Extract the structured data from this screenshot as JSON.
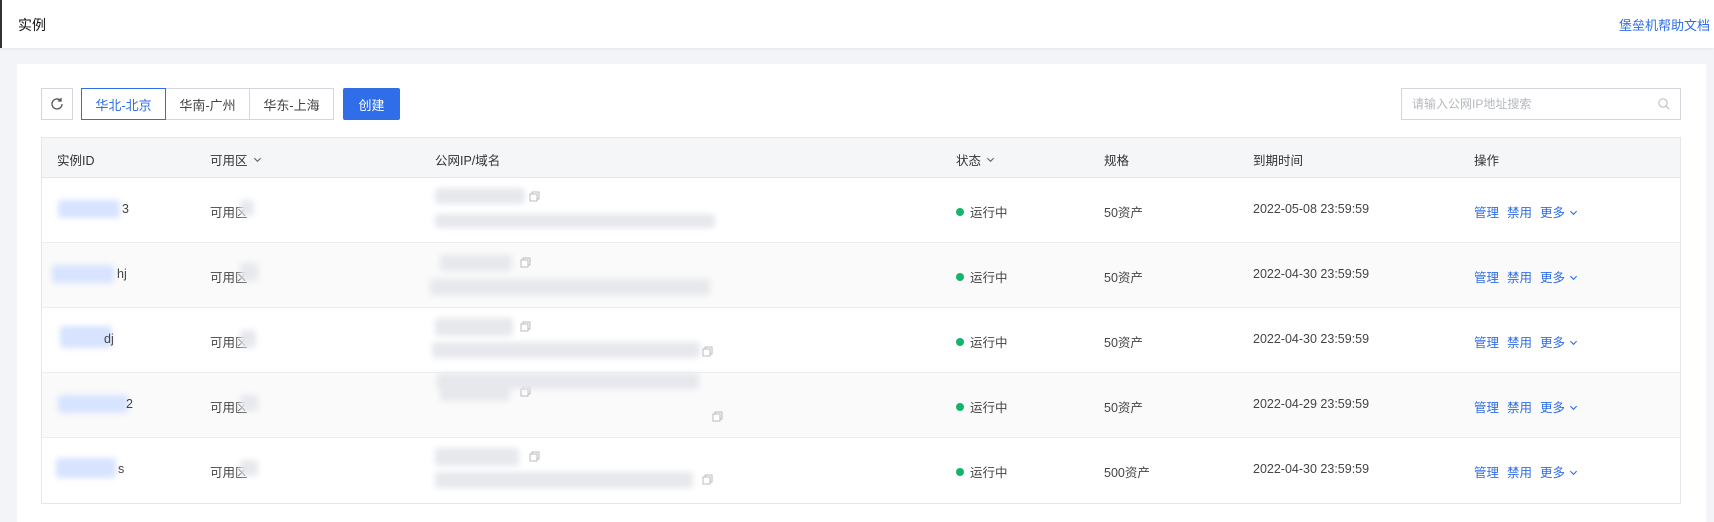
{
  "header": {
    "title": "实例",
    "help_link": "堡垒机帮助文档"
  },
  "toolbar": {
    "regions": [
      "华北-北京",
      "华南-广州",
      "华东-上海"
    ],
    "active_region": "华北-北京",
    "create_label": "创建",
    "search_placeholder": "请输入公网IP地址搜索"
  },
  "table": {
    "columns": [
      "实例ID",
      "可用区",
      "公网IP/域名",
      "状态",
      "规格",
      "到期时间",
      "操作"
    ],
    "rows": [
      {
        "id_tail": "3",
        "zone": "可用区",
        "status": "运行中",
        "spec": "50资产",
        "expire": "2022-05-08 23:59:59"
      },
      {
        "id_tail": "hj",
        "zone": "可用区",
        "status": "运行中",
        "spec": "50资产",
        "expire": "2022-04-30 23:59:59"
      },
      {
        "id_tail": "dj",
        "zone": "可用区",
        "status": "运行中",
        "spec": "50资产",
        "expire": "2022-04-30 23:59:59"
      },
      {
        "id_tail": "2",
        "zone": "可用区",
        "status": "运行中",
        "spec": "50资产",
        "expire": "2022-04-29 23:59:59"
      },
      {
        "id_tail": "s",
        "zone": "可用区",
        "status": "运行中",
        "spec": "500资产",
        "expire": "2022-04-30 23:59:59"
      }
    ],
    "actions": {
      "manage": "管理",
      "disable": "禁用",
      "more": "更多"
    }
  },
  "colors": {
    "accent": "#2f6ee8",
    "running": "#12b56a"
  }
}
